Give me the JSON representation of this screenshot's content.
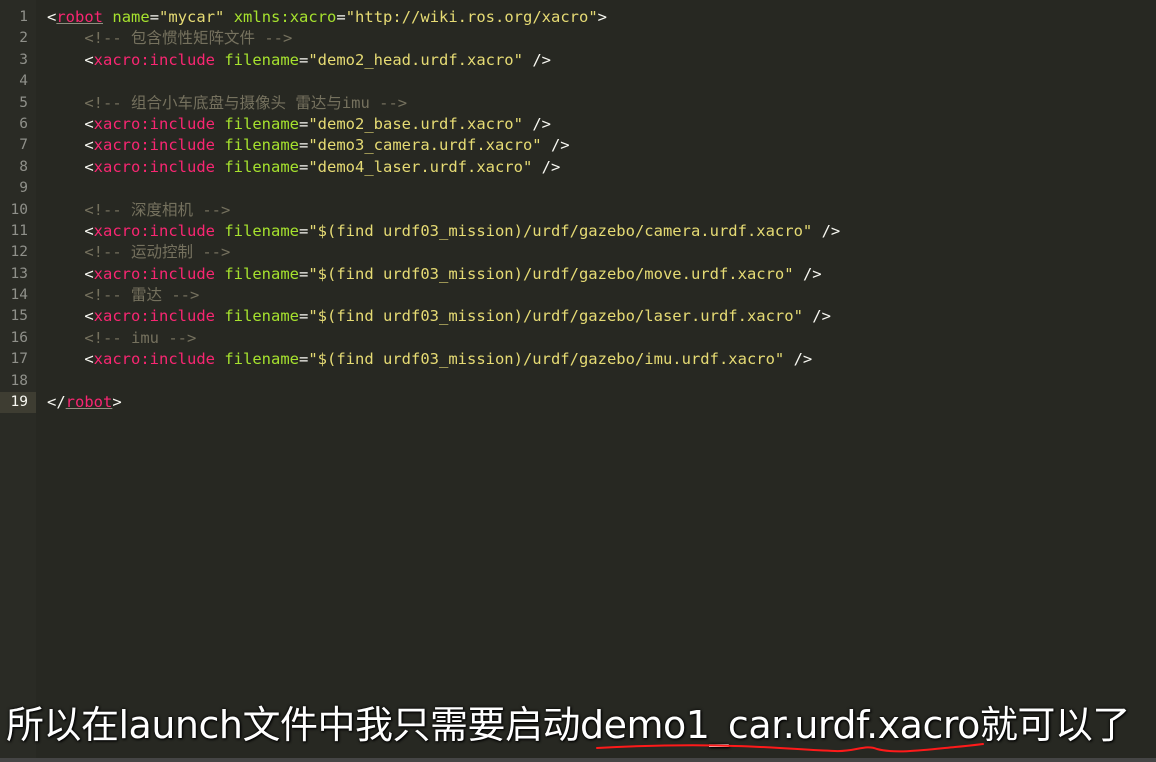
{
  "editor": {
    "lines": [
      {
        "n": "1",
        "tokens": [
          {
            "t": "<",
            "c": "punct"
          },
          {
            "t": "robot",
            "c": "tag underline"
          },
          {
            "t": " ",
            "c": "txt"
          },
          {
            "t": "name",
            "c": "attr"
          },
          {
            "t": "=",
            "c": "punct"
          },
          {
            "t": "\"mycar\"",
            "c": "str"
          },
          {
            "t": " ",
            "c": "txt"
          },
          {
            "t": "xmlns:xacro",
            "c": "attr"
          },
          {
            "t": "=",
            "c": "punct"
          },
          {
            "t": "\"http://wiki.ros.org/xacro\"",
            "c": "str"
          },
          {
            "t": ">",
            "c": "punct"
          }
        ]
      },
      {
        "n": "2",
        "tokens": [
          {
            "t": "    ",
            "c": "txt"
          },
          {
            "t": "<!-- 包含惯性矩阵文件 -->",
            "c": "com"
          }
        ]
      },
      {
        "n": "3",
        "tokens": [
          {
            "t": "    ",
            "c": "txt"
          },
          {
            "t": "<",
            "c": "punct"
          },
          {
            "t": "xacro:include",
            "c": "tag"
          },
          {
            "t": " ",
            "c": "txt"
          },
          {
            "t": "filename",
            "c": "attr"
          },
          {
            "t": "=",
            "c": "punct"
          },
          {
            "t": "\"demo2_head.urdf.xacro\"",
            "c": "str"
          },
          {
            "t": " />",
            "c": "punct"
          }
        ]
      },
      {
        "n": "4",
        "tokens": []
      },
      {
        "n": "5",
        "tokens": [
          {
            "t": "    ",
            "c": "txt"
          },
          {
            "t": "<!-- 组合小车底盘与摄像头 雷达与imu -->",
            "c": "com"
          }
        ]
      },
      {
        "n": "6",
        "tokens": [
          {
            "t": "    ",
            "c": "txt"
          },
          {
            "t": "<",
            "c": "punct"
          },
          {
            "t": "xacro:include",
            "c": "tag"
          },
          {
            "t": " ",
            "c": "txt"
          },
          {
            "t": "filename",
            "c": "attr"
          },
          {
            "t": "=",
            "c": "punct"
          },
          {
            "t": "\"demo2_base.urdf.xacro\"",
            "c": "str"
          },
          {
            "t": " />",
            "c": "punct"
          }
        ]
      },
      {
        "n": "7",
        "tokens": [
          {
            "t": "    ",
            "c": "txt"
          },
          {
            "t": "<",
            "c": "punct"
          },
          {
            "t": "xacro:include",
            "c": "tag"
          },
          {
            "t": " ",
            "c": "txt"
          },
          {
            "t": "filename",
            "c": "attr"
          },
          {
            "t": "=",
            "c": "punct"
          },
          {
            "t": "\"demo3_camera.urdf.xacro\"",
            "c": "str"
          },
          {
            "t": " />",
            "c": "punct"
          }
        ]
      },
      {
        "n": "8",
        "tokens": [
          {
            "t": "    ",
            "c": "txt"
          },
          {
            "t": "<",
            "c": "punct"
          },
          {
            "t": "xacro:include",
            "c": "tag"
          },
          {
            "t": " ",
            "c": "txt"
          },
          {
            "t": "filename",
            "c": "attr"
          },
          {
            "t": "=",
            "c": "punct"
          },
          {
            "t": "\"demo4_laser.urdf.xacro\"",
            "c": "str"
          },
          {
            "t": " />",
            "c": "punct"
          }
        ]
      },
      {
        "n": "9",
        "tokens": []
      },
      {
        "n": "10",
        "tokens": [
          {
            "t": "    ",
            "c": "txt"
          },
          {
            "t": "<!-- 深度相机 -->",
            "c": "com"
          }
        ]
      },
      {
        "n": "11",
        "tokens": [
          {
            "t": "    ",
            "c": "txt"
          },
          {
            "t": "<",
            "c": "punct"
          },
          {
            "t": "xacro:include",
            "c": "tag"
          },
          {
            "t": " ",
            "c": "txt"
          },
          {
            "t": "filename",
            "c": "attr"
          },
          {
            "t": "=",
            "c": "punct"
          },
          {
            "t": "\"$(find urdf03_mission)/urdf/gazebo/camera.urdf.xacro\"",
            "c": "str"
          },
          {
            "t": " />",
            "c": "punct"
          }
        ]
      },
      {
        "n": "12",
        "tokens": [
          {
            "t": "    ",
            "c": "txt"
          },
          {
            "t": "<!-- 运动控制 -->",
            "c": "com"
          }
        ]
      },
      {
        "n": "13",
        "tokens": [
          {
            "t": "    ",
            "c": "txt"
          },
          {
            "t": "<",
            "c": "punct"
          },
          {
            "t": "xacro:include",
            "c": "tag"
          },
          {
            "t": " ",
            "c": "txt"
          },
          {
            "t": "filename",
            "c": "attr"
          },
          {
            "t": "=",
            "c": "punct"
          },
          {
            "t": "\"$(find urdf03_mission)/urdf/gazebo/move.urdf.xacro\"",
            "c": "str"
          },
          {
            "t": " />",
            "c": "punct"
          }
        ]
      },
      {
        "n": "14",
        "tokens": [
          {
            "t": "    ",
            "c": "txt"
          },
          {
            "t": "<!-- 雷达 -->",
            "c": "com"
          }
        ]
      },
      {
        "n": "15",
        "tokens": [
          {
            "t": "    ",
            "c": "txt"
          },
          {
            "t": "<",
            "c": "punct"
          },
          {
            "t": "xacro:include",
            "c": "tag"
          },
          {
            "t": " ",
            "c": "txt"
          },
          {
            "t": "filename",
            "c": "attr"
          },
          {
            "t": "=",
            "c": "punct"
          },
          {
            "t": "\"$(find urdf03_mission)/urdf/gazebo/laser.urdf.xacro\"",
            "c": "str"
          },
          {
            "t": " />",
            "c": "punct"
          }
        ]
      },
      {
        "n": "16",
        "tokens": [
          {
            "t": "    ",
            "c": "txt"
          },
          {
            "t": "<!-- imu -->",
            "c": "com"
          }
        ]
      },
      {
        "n": "17",
        "tokens": [
          {
            "t": "    ",
            "c": "txt"
          },
          {
            "t": "<",
            "c": "punct"
          },
          {
            "t": "xacro:include",
            "c": "tag"
          },
          {
            "t": " ",
            "c": "txt"
          },
          {
            "t": "filename",
            "c": "attr"
          },
          {
            "t": "=",
            "c": "punct"
          },
          {
            "t": "\"$(find urdf03_mission)/urdf/gazebo/imu.urdf.xacro\"",
            "c": "str"
          },
          {
            "t": " />",
            "c": "punct"
          }
        ]
      },
      {
        "n": "18",
        "tokens": []
      },
      {
        "n": "19",
        "tokens": [
          {
            "t": "</",
            "c": "punct"
          },
          {
            "t": "robot",
            "c": "tag underline"
          },
          {
            "t": ">",
            "c": "punct"
          }
        ]
      }
    ],
    "current_line": "19"
  },
  "caption": {
    "text": "所以在launch文件中我只需要启动demo1_car.urdf.xacro就可以了"
  },
  "colors": {
    "background": "#272822",
    "tag": "#f92672",
    "attribute": "#a6e22e",
    "string": "#e6db74",
    "comment": "#75715e",
    "line_number": "#8f908a",
    "annotation": "#ff1a1a"
  }
}
